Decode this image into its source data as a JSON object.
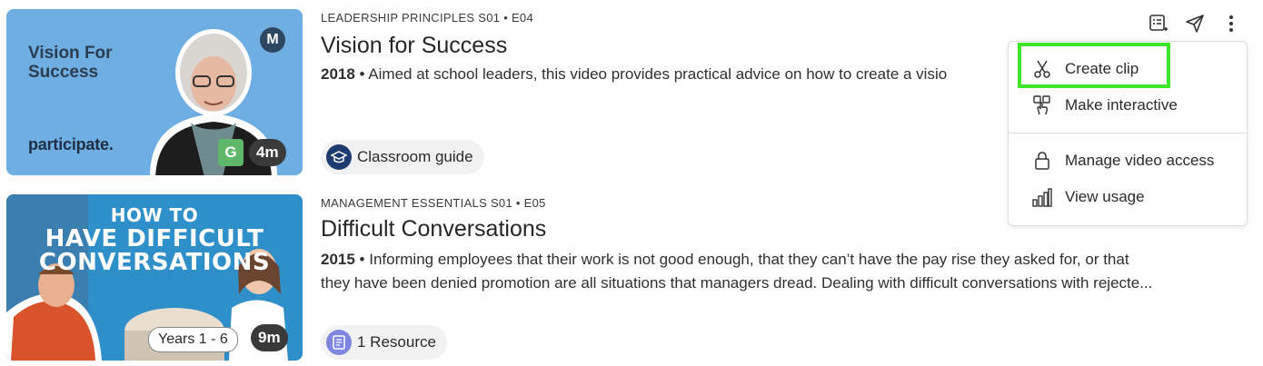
{
  "videos": [
    {
      "meta": "LEADERSHIP PRINCIPLES S01 • E04",
      "title": "Vision for Success",
      "year": "2018",
      "description": "Aimed at school leaders, this video provides practical advice on how to create a visio",
      "thumb_title_line1": "Vision For",
      "thumb_title_line2": "Success",
      "thumb_brand": "participate.",
      "thumb_logo": "M",
      "badge": "G",
      "duration": "4m",
      "chip": "Classroom guide",
      "chip_icon": "graduation-cap-icon"
    },
    {
      "meta": "MANAGEMENT ESSENTIALS S01 • E05",
      "title": "Difficult Conversations",
      "year": "2015",
      "description_line1": "Informing employees that their work is not good enough, that they can’t have the pay rise they asked for, or that",
      "description_line2": "they have been denied promotion are all situations that managers dread. Dealing with difficult conversations with rejecte...",
      "thumb_title_line1": "HOW TO",
      "thumb_title_line2": "HAVE DIFFICULT",
      "thumb_title_line3": "CONVERSATIONS",
      "years": "Years 1 - 6",
      "duration": "9m",
      "chip": "1 Resource",
      "chip_icon": "document-icon"
    }
  ],
  "actions": [
    "add-to-playlist-icon",
    "share-icon",
    "more-vertical-icon"
  ],
  "menu": {
    "items": [
      {
        "label": "Create clip",
        "icon": "scissors-icon"
      },
      {
        "label": "Make interactive",
        "icon": "interactive-hand-icon"
      },
      {
        "label": "Manage video access",
        "icon": "lock-icon"
      },
      {
        "label": "View usage",
        "icon": "bar-chart-icon"
      }
    ],
    "highlight_color": "#3ee62a"
  },
  "colors": {
    "thumb1_bg": "#6faee2",
    "thumb2_bg": "#2f8fc9",
    "badge_green": "#5fb86a"
  }
}
